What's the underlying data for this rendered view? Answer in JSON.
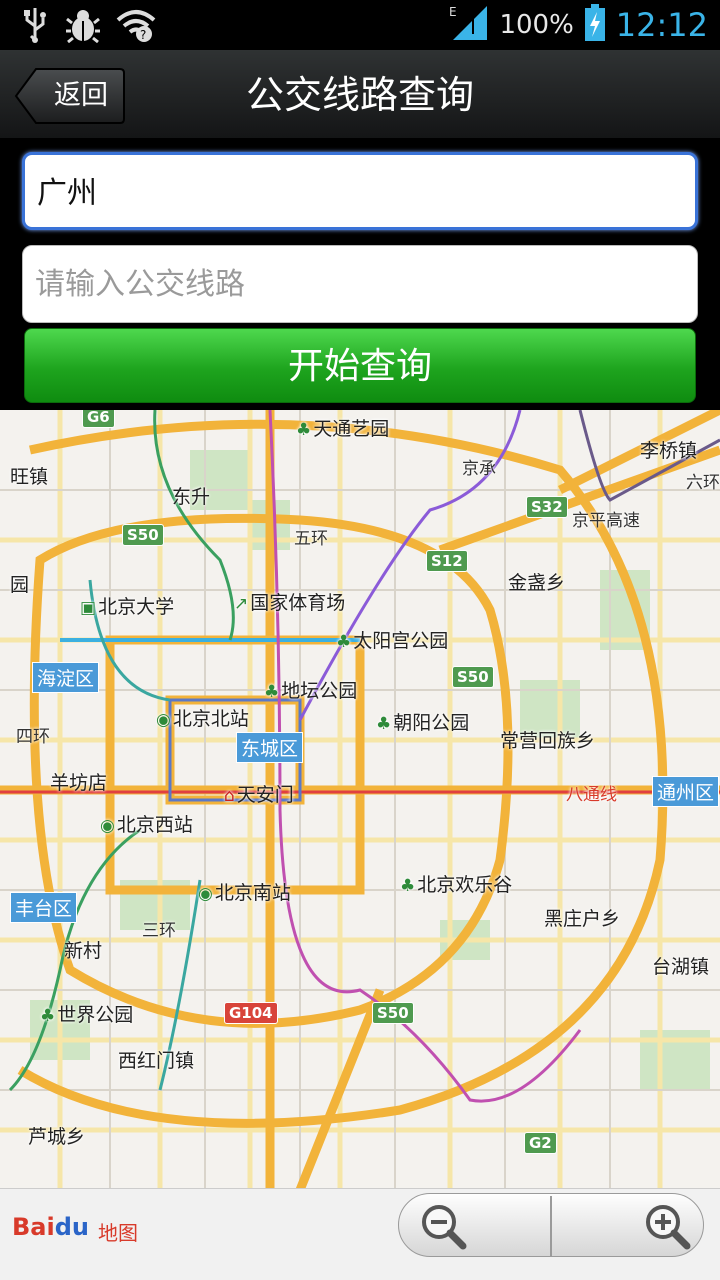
{
  "status_bar": {
    "battery_pct": "100%",
    "clock": "12:12",
    "network_letter": "E",
    "icons": [
      "usb-icon",
      "debug-icon",
      "wifi-icon",
      "signal-icon",
      "battery-charging-icon"
    ]
  },
  "header": {
    "back_label": "返回",
    "title": "公交线路查询"
  },
  "form": {
    "city_value": "广州",
    "route_placeholder": "请输入公交线路",
    "search_label": "开始查询"
  },
  "map": {
    "places": [
      "天通艺园",
      "李桥镇",
      "旺镇",
      "东升",
      "金盏乡",
      "园",
      "北京大学",
      "国家体育场",
      "太阳宫公园",
      "地坛公园",
      "北京北站",
      "朝阳公园",
      "常营回族乡",
      "羊坊店",
      "天安门",
      "北京西站",
      "北京欢乐谷",
      "北京南站",
      "黑庄户乡",
      "新村",
      "台湖镇",
      "世界公园",
      "西红门镇",
      "芦城乡"
    ],
    "districts": [
      "海淀区",
      "东城区",
      "通州区",
      "丰台区"
    ],
    "roads": [
      "五环",
      "四环",
      "京承",
      "京平高速",
      "八通线",
      "三环",
      "六环"
    ],
    "badges": [
      "G6",
      "S32",
      "S12",
      "S50",
      "S50",
      "S50",
      "G104",
      "G2"
    ]
  },
  "footer": {
    "logo_text_bai": "Bai",
    "logo_text_du": "du",
    "logo_text_map": "地图"
  },
  "colors": {
    "accent_blue": "#3ab4e8",
    "button_green": "#1ea41e",
    "input_focus": "#3a73d8"
  }
}
